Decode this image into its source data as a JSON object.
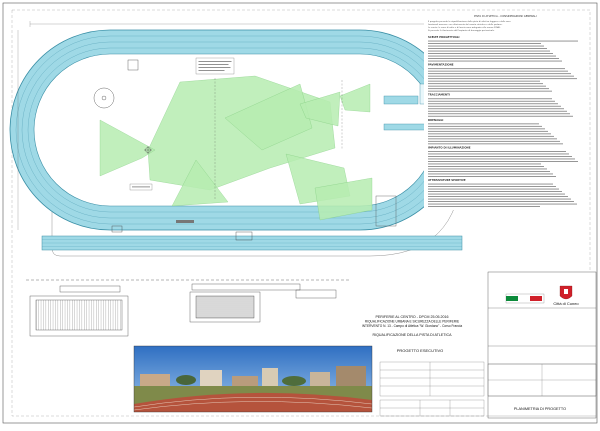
{
  "drawing": {
    "title": "PISTA DI ATLETICA",
    "subtitle": "CITTÀ DI CUNEO"
  },
  "notes_header": "PISTA DI ATLETICA - CONSIDERAZIONI GENERALI",
  "notes_lines": [
    "Il progetto prevede la riqualificazione della pista di atletica leggera e delle aree",
    "funzionali annesse, con rifacimento del manto sintetico e delle pedane.",
    "Le corsie, le zone di salto e di lancio sono adeguate alle norme FIDAL.",
    "Si prevede il rifacimento dell'impianto di drenaggio perimetrale."
  ],
  "sections": [
    {
      "heading": "SCELTE PROGETTUALI",
      "lines": 9
    },
    {
      "heading": "PAVIMENTAZIONE",
      "lines": 10
    },
    {
      "heading": "TRACCIAMENTI",
      "lines": 8
    },
    {
      "heading": "DRENAGGI",
      "lines": 9
    },
    {
      "heading": "IMPIANTO DI ILLUMINAZIONE",
      "lines": 11
    },
    {
      "heading": "ATTREZZATURE SPORTIVE",
      "lines": 10
    }
  ],
  "title_block": {
    "program_line1": "PERIFERIE AL CENTRO - DPCM 25.05.2016",
    "program_line2": "RIQUALIFICAZIONE URBANA E SICUREZZA DELLE PERIFERIE",
    "program_line3": "INTERVENTO N. 13 - Campo di Atletica \"W. Giordano\" - Corso Francia",
    "subject": "RIQUALIFICAZIONE DELLA PISTA DI ATLETICA",
    "phase": "PROGETTO ESECUTIVO",
    "sheet_title": "PLANIMETRIA DI PROGETTO",
    "city": "Città di Cuneo"
  },
  "photo": {
    "caption": ""
  },
  "colors": {
    "track": "#9fd9e6",
    "track_line": "#3a8fa6",
    "field": "#c8f0c2",
    "light_cone": "#b6ecb0",
    "line": "#444444",
    "flag_green": "#0b8a3a",
    "flag_red": "#d0202a"
  }
}
